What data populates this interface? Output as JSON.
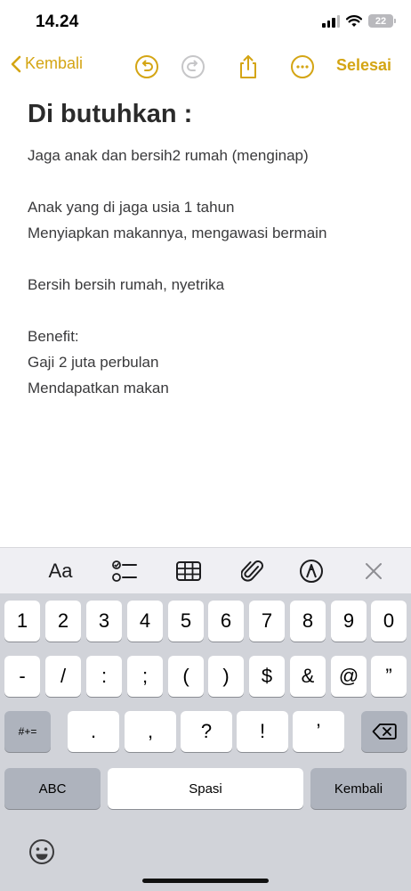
{
  "status_bar": {
    "time": "14.24",
    "battery": "22"
  },
  "nav": {
    "back_label": "Kembali",
    "done_label": "Selesai",
    "icons": [
      "undo-icon",
      "redo-icon",
      "share-icon",
      "more-icon"
    ]
  },
  "note": {
    "title": "Di butuhkan :",
    "lines": [
      "Jaga anak dan bersih2 rumah (menginap)",
      "",
      "Anak yang di jaga  usia 1 tahun",
      "Menyiapkan makannya, mengawasi bermain",
      "",
      "Bersih bersih rumah, nyetrika",
      "",
      "Benefit:",
      "Gaji 2 juta perbulan",
      "Mendapatkan makan"
    ]
  },
  "format_bar": {
    "text_format_label": "Aa",
    "icons": [
      "checklist-icon",
      "table-icon",
      "attachment-icon",
      "markup-icon",
      "close-icon"
    ]
  },
  "keyboard": {
    "row1": [
      "1",
      "2",
      "3",
      "4",
      "5",
      "6",
      "7",
      "8",
      "9",
      "0"
    ],
    "row2": [
      "-",
      "/",
      ":",
      ";",
      "(",
      ")",
      "$",
      "&",
      "@",
      "”"
    ],
    "row3_left": "#+=",
    "row3": [
      ".",
      ",",
      "?",
      "!",
      "’"
    ],
    "row3_right": "delete-icon",
    "row4_left": "ABC",
    "space": "Spasi",
    "return": "Kembali",
    "emoji": "emoji-icon"
  },
  "colors": {
    "accent": "#d4a514",
    "keyboard_bg": "#d1d3d9",
    "toolbar_bg": "#efeff3"
  }
}
